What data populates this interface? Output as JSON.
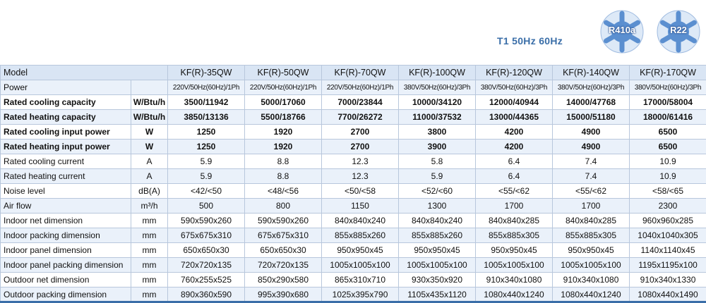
{
  "header": {
    "spec_line": "T1   50Hz   60Hz",
    "badges": [
      {
        "label": "R410a",
        "color": "#5b8fd0"
      },
      {
        "label": "R22",
        "color": "#5b8fd0"
      }
    ]
  },
  "table": {
    "model_label": "Model",
    "models": [
      "KF(R)-35QW",
      "KF(R)-50QW",
      "KF(R)-70QW",
      "KF(R)-100QW",
      "KF(R)-120QW",
      "KF(R)-140QW",
      "KF(R)-170QW"
    ],
    "rows": [
      {
        "label": "Power",
        "unit": "",
        "bold": false,
        "values": [
          "220V/50Hz(60Hz)/1Ph",
          "220V/50Hz(60Hz)/1Ph",
          "220V/50Hz(60Hz)/1Ph",
          "380V/50Hz(60Hz)/3Ph",
          "380V/50Hz(60Hz)/3Ph",
          "380V/50Hz(60Hz)/3Ph",
          "380V/50Hz(60Hz)/3Ph"
        ]
      },
      {
        "label": "Rated cooling capacity",
        "unit": "W/Btu/h",
        "bold": true,
        "values": [
          "3500/11942",
          "5000/17060",
          "7000/23844",
          "10000/34120",
          "12000/40944",
          "14000/47768",
          "17000/58004"
        ]
      },
      {
        "label": "Rated heating capacity",
        "unit": "W/Btu/h",
        "bold": true,
        "values": [
          "3850/13136",
          "5500/18766",
          "7700/26272",
          "11000/37532",
          "13000/44365",
          "15000/51180",
          "18000/61416"
        ]
      },
      {
        "label": "Rated cooling input power",
        "unit": "W",
        "bold": true,
        "values": [
          "1250",
          "1920",
          "2700",
          "3800",
          "4200",
          "4900",
          "6500"
        ]
      },
      {
        "label": "Rated heating input power",
        "unit": "W",
        "bold": true,
        "values": [
          "1250",
          "1920",
          "2700",
          "3900",
          "4200",
          "4900",
          "6500"
        ]
      },
      {
        "label": "Rated cooling current",
        "unit": "A",
        "bold": false,
        "values": [
          "5.9",
          "8.8",
          "12.3",
          "5.8",
          "6.4",
          "7.4",
          "10.9"
        ]
      },
      {
        "label": "Rated heating current",
        "unit": "A",
        "bold": false,
        "values": [
          "5.9",
          "8.8",
          "12.3",
          "5.9",
          "6.4",
          "7.4",
          "10.9"
        ]
      },
      {
        "label": "Noise level",
        "unit": "dB(A)",
        "bold": false,
        "values": [
          "<42/<50",
          "<48/<56",
          "<50/<58",
          "<52/<60",
          "<55/<62",
          "<55/<62",
          "<58/<65"
        ]
      },
      {
        "label": "Air flow",
        "unit": "m³/h",
        "bold": false,
        "values": [
          "500",
          "800",
          "1150",
          "1300",
          "1700",
          "1700",
          "2300"
        ]
      },
      {
        "label": "Indoor net dimension",
        "unit": "mm",
        "bold": false,
        "values": [
          "590x590x260",
          "590x590x260",
          "840x840x240",
          "840x840x240",
          "840x840x285",
          "840x840x285",
          "960x960x285"
        ]
      },
      {
        "label": "Indoor packing dimension",
        "unit": "mm",
        "bold": false,
        "values": [
          "675x675x310",
          "675x675x310",
          "855x885x260",
          "855x885x260",
          "855x885x305",
          "855x885x305",
          "1040x1040x305"
        ]
      },
      {
        "label": "Indoor panel dimension",
        "unit": "mm",
        "bold": false,
        "values": [
          "650x650x30",
          "650x650x30",
          "950x950x45",
          "950x950x45",
          "950x950x45",
          "950x950x45",
          "1140x1140x45"
        ]
      },
      {
        "label": "Indoor panel packing dimension",
        "unit": "mm",
        "bold": false,
        "values": [
          "720x720x135",
          "720x720x135",
          "1005x1005x100",
          "1005x1005x100",
          "1005x1005x100",
          "1005x1005x100",
          "1195x1195x100"
        ]
      },
      {
        "label": "Outdoor net dimension",
        "unit": "mm",
        "bold": false,
        "values": [
          "760x255x525",
          "850x290x580",
          "865x310x710",
          "930x350x920",
          "910x340x1080",
          "910x340x1080",
          "910x340x1330"
        ]
      },
      {
        "label": "Outdoor packing dimension",
        "unit": "mm",
        "bold": false,
        "values": [
          "890x360x590",
          "995x390x680",
          "1025x395x790",
          "1105x435x1120",
          "1080x440x1240",
          "1080x440x1240",
          "1080x440x1490"
        ]
      }
    ]
  }
}
